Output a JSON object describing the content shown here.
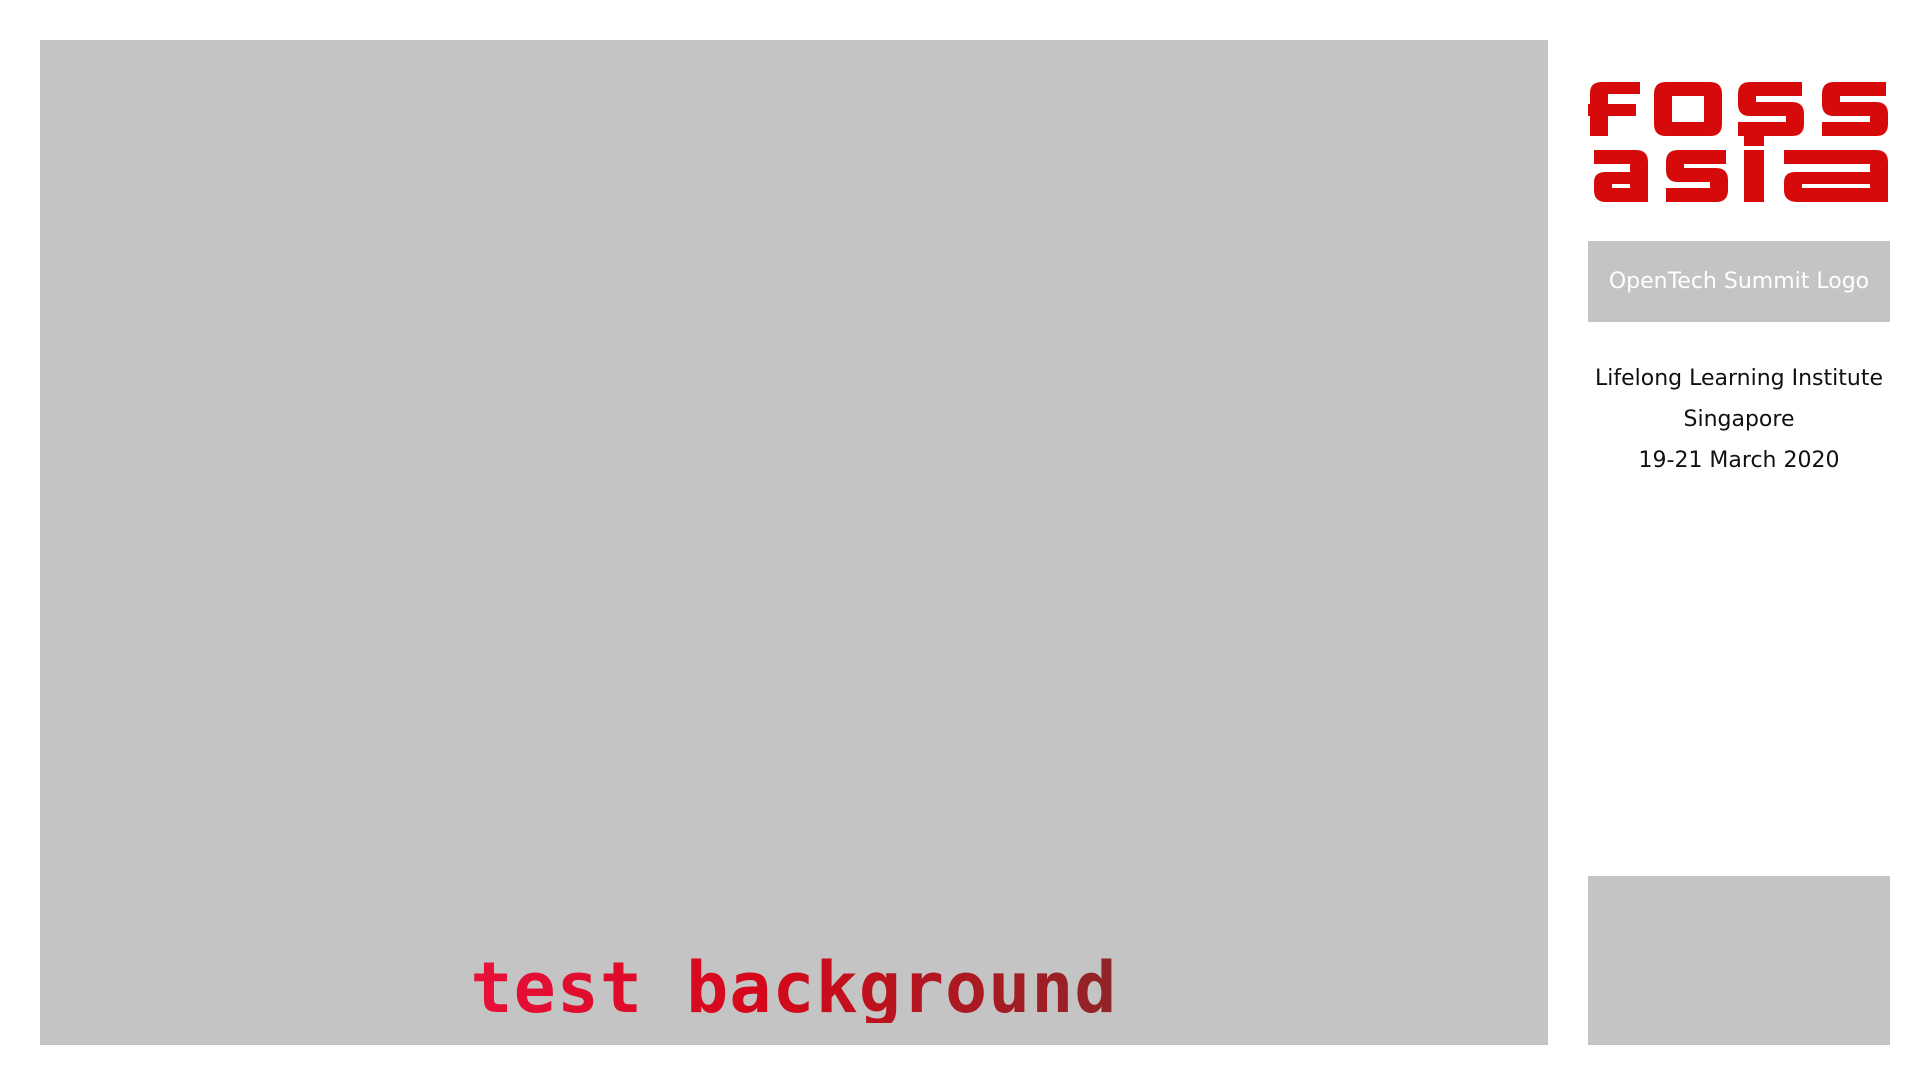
{
  "main": {
    "title": "test background"
  },
  "sidebar": {
    "brand_logo": {
      "line1": "foss",
      "line2": "asia",
      "color": "#d60a0a"
    },
    "opentech_logo_label": "OpenTech Summit Logo",
    "event": {
      "venue": "Lifelong Learning Institute",
      "city": "Singapore",
      "dates": "19-21 March 2020"
    }
  },
  "colors": {
    "placeholder_gray": "#c4c4c4",
    "title_gradient_start": "#e8103a",
    "title_gradient_end": "#8e2527"
  }
}
